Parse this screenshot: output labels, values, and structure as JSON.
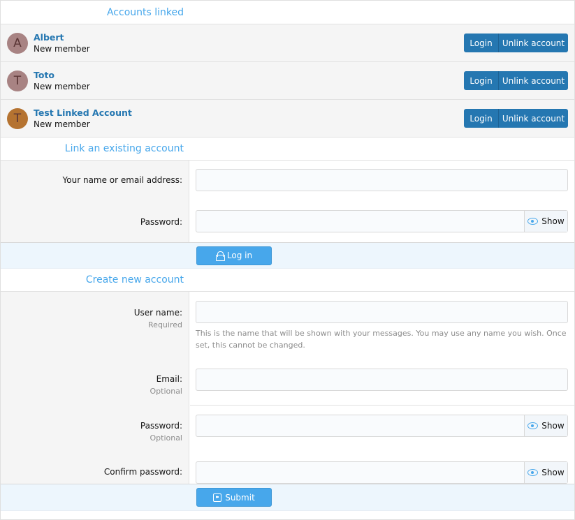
{
  "accounts_section": {
    "title": "Accounts linked",
    "accounts": [
      {
        "initial": "A",
        "name": "Albert",
        "role": "New member",
        "avatar_color": "#a88383"
      },
      {
        "initial": "T",
        "name": "Toto",
        "role": "New member",
        "avatar_color": "#a88383"
      },
      {
        "initial": "T",
        "name": "Test Linked Account",
        "role": "New member",
        "avatar_color": "#b57331"
      }
    ],
    "login_label": "Login",
    "unlink_label": "Unlink account"
  },
  "link_section": {
    "title": "Link an existing account",
    "name_label": "Your name or email address:",
    "password_label": "Password:",
    "show_label": "Show",
    "login_button": "Log in"
  },
  "create_section": {
    "title": "Create new account",
    "username_label": "User name:",
    "username_hint": "Required",
    "username_explain": "This is the name that will be shown with your messages. You may use any name you wish. Once set, this cannot be changed.",
    "email_label": "Email:",
    "email_hint": "Optional",
    "password_label": "Password:",
    "password_hint": "Optional",
    "confirm_label": "Confirm password:",
    "show_label": "Show",
    "submit_button": "Submit"
  },
  "colors": {
    "accent": "#47a7eb",
    "primary_button": "#2577b1",
    "link_text": "#2577b1"
  }
}
